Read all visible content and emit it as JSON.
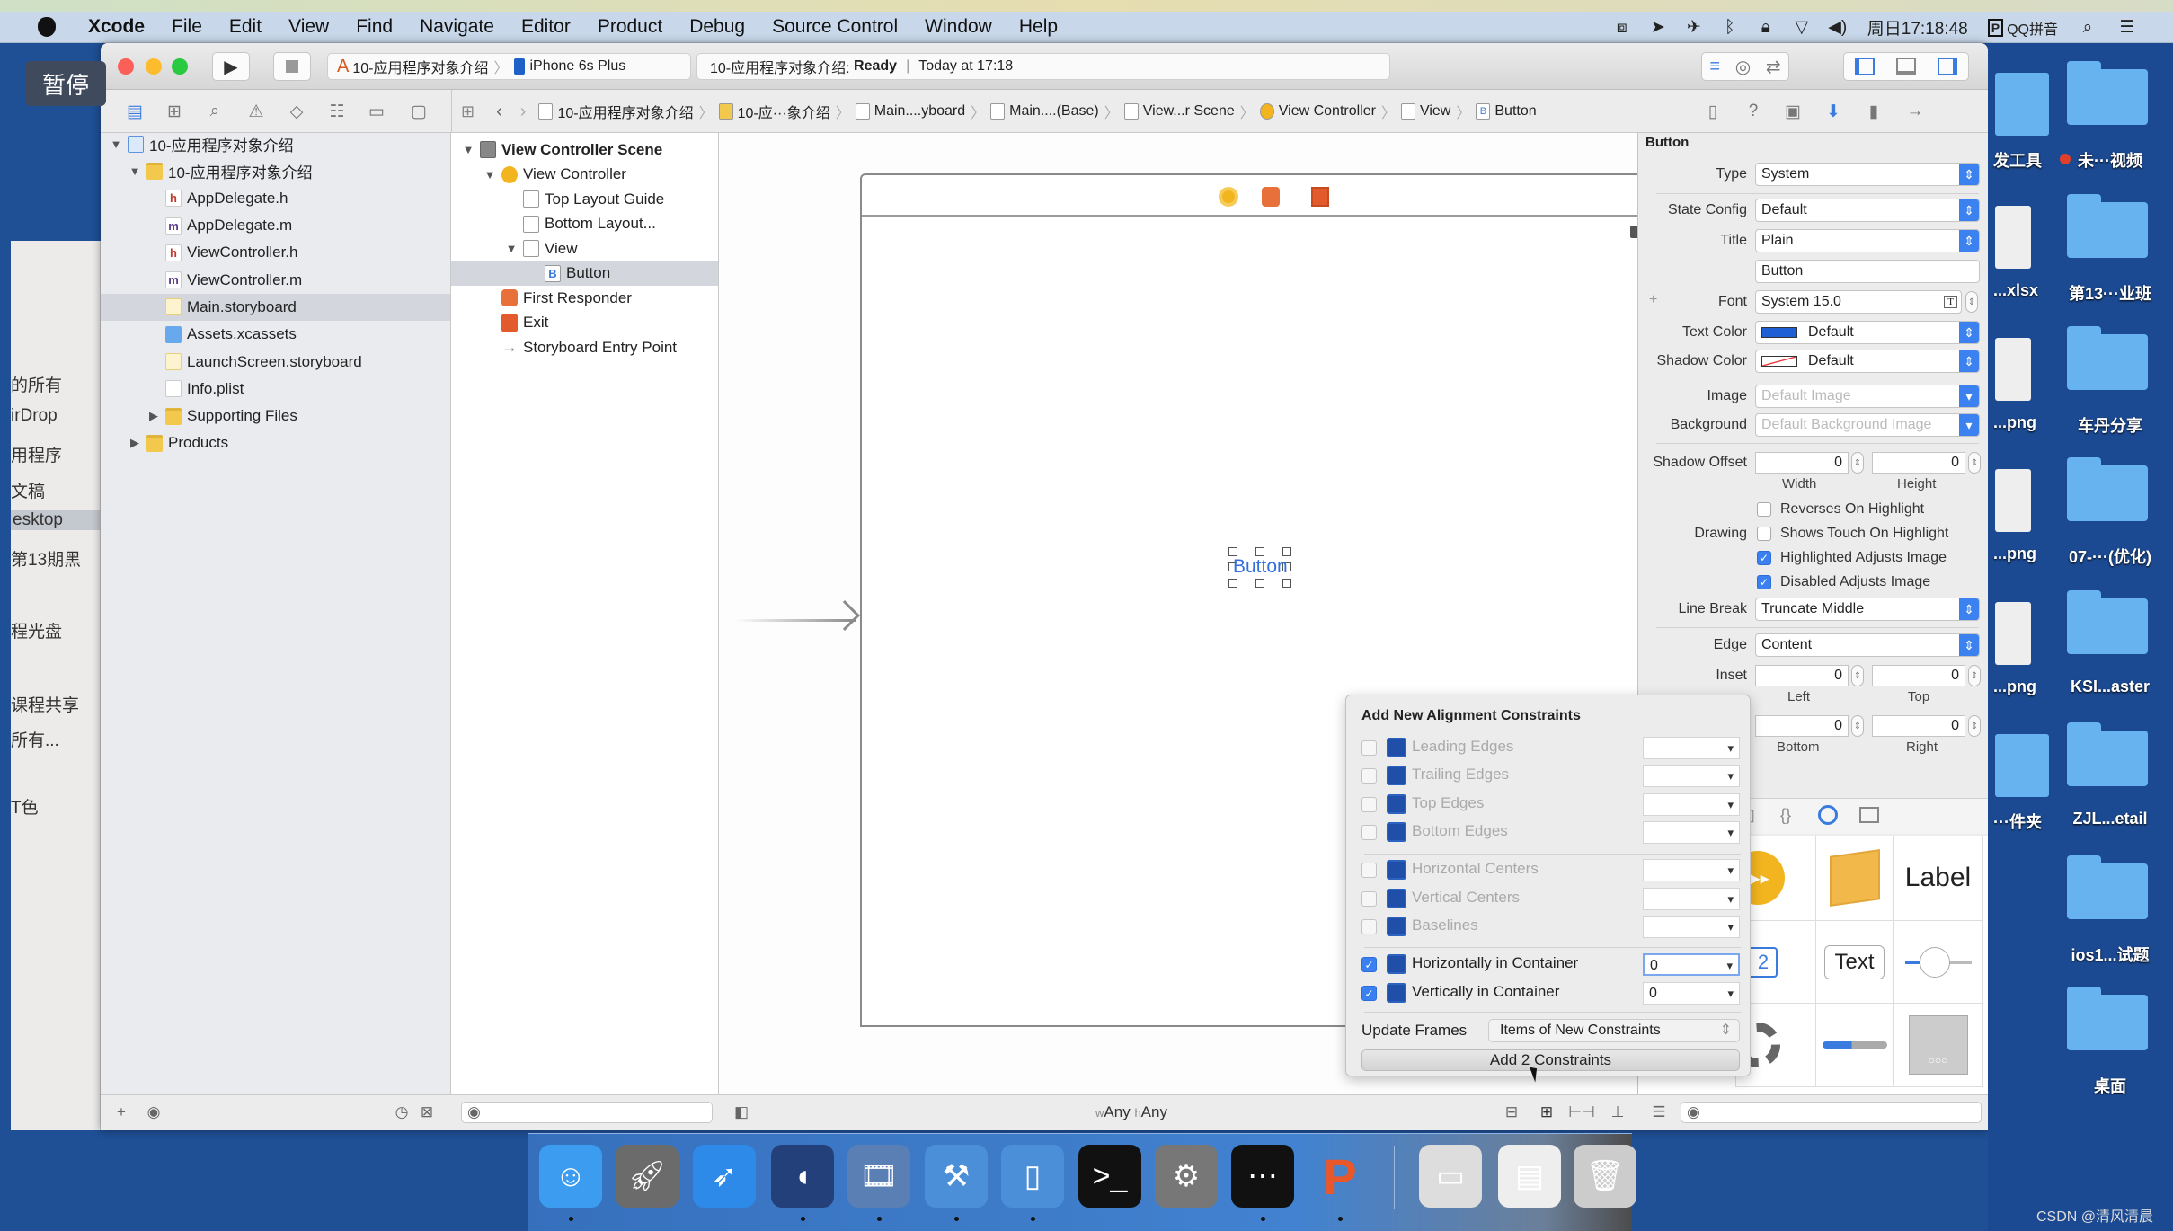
{
  "menubar": {
    "app": "Xcode",
    "items": [
      "File",
      "Edit",
      "View",
      "Find",
      "Navigate",
      "Editor",
      "Product",
      "Debug",
      "Source Control",
      "Window",
      "Help"
    ],
    "status_icons": [
      "screen-record-icon",
      "location-icon",
      "airplane-icon",
      "bluetooth-icon",
      "lock-icon",
      "wifi-icon",
      "volume-icon"
    ],
    "clock": "周日17:18:48",
    "input_method": "QQ拼音"
  },
  "overlay": {
    "pause_label": "暂停",
    "watermark": "CSDN @清风清晨"
  },
  "finder_sidebar": [
    "的所有",
    "irDrop",
    "用程序",
    "文稿",
    "esktop",
    "第13期黑",
    "程光盘",
    "课程共享",
    "所有...",
    "T色"
  ],
  "toolbar": {
    "scheme": "10-应用程序对象介绍",
    "device": "iPhone 6s Plus",
    "status_project": "10-应用程序对象介绍:",
    "status_state": "Ready",
    "status_time": "Today at 17:18"
  },
  "jumpbar": [
    "10-应用程序对象介绍",
    "10-应···象介绍",
    "Main....yboard",
    "Main....(Base)",
    "View...r Scene",
    "View Controller",
    "View",
    "Button"
  ],
  "navigator": {
    "items": [
      {
        "label": "10-应用程序对象介绍",
        "level": 0,
        "icon": "proj",
        "expanded": true
      },
      {
        "label": "10-应用程序对象介绍",
        "level": 1,
        "icon": "folder",
        "expanded": true
      },
      {
        "label": "AppDelegate.h",
        "level": 2,
        "icon": "h"
      },
      {
        "label": "AppDelegate.m",
        "level": 2,
        "icon": "m"
      },
      {
        "label": "ViewController.h",
        "level": 2,
        "icon": "h"
      },
      {
        "label": "ViewController.m",
        "level": 2,
        "icon": "m"
      },
      {
        "label": "Main.storyboard",
        "level": 2,
        "icon": "sb",
        "selected": true
      },
      {
        "label": "Assets.xcassets",
        "level": 2,
        "icon": "assets"
      },
      {
        "label": "LaunchScreen.storyboard",
        "level": 2,
        "icon": "sb"
      },
      {
        "label": "Info.plist",
        "level": 2,
        "icon": "plist"
      },
      {
        "label": "Supporting Files",
        "level": 2,
        "icon": "folder",
        "expanded": false
      },
      {
        "label": "Products",
        "level": 1,
        "icon": "folder",
        "expanded": false
      }
    ]
  },
  "outline": {
    "items": [
      {
        "label": "View Controller Scene",
        "level": 0,
        "icon": "scene",
        "expanded": true,
        "bold": true
      },
      {
        "label": "View Controller",
        "level": 1,
        "icon": "vc",
        "expanded": true
      },
      {
        "label": "Top Layout Guide",
        "level": 2,
        "icon": "guide"
      },
      {
        "label": "Bottom Layout...",
        "level": 2,
        "icon": "guide"
      },
      {
        "label": "View",
        "level": 2,
        "icon": "view",
        "expanded": true
      },
      {
        "label": "Button",
        "level": 3,
        "icon": "btn",
        "selected": true
      },
      {
        "label": "First Responder",
        "level": 1,
        "icon": "fr"
      },
      {
        "label": "Exit",
        "level": 1,
        "icon": "exit"
      },
      {
        "label": "Storyboard Entry Point",
        "level": 1,
        "icon": "entry"
      }
    ]
  },
  "canvas": {
    "button_title": "Button",
    "size_class_w": "w",
    "size_class_w_value": "Any",
    "size_class_h": "h",
    "size_class_h_value": "Any"
  },
  "inspector": {
    "section": "Button",
    "type_label": "Type",
    "type": "System",
    "state_config_label": "State Config",
    "state_config": "Default",
    "title_label": "Title",
    "title_style": "Plain",
    "title_text": "Button",
    "font_label": "Font",
    "font": "System 15.0",
    "text_color_label": "Text Color",
    "text_color": "Default",
    "text_color_swatch": "#1f5fd6",
    "shadow_color_label": "Shadow Color",
    "shadow_color": "Default",
    "image_label": "Image",
    "image_placeholder": "Default Image",
    "background_label": "Background",
    "background_placeholder": "Default Background Image",
    "shadow_offset_label": "Shadow Offset",
    "shadow_width": "0",
    "shadow_height": "0",
    "width_label": "Width",
    "height_label": "Height",
    "drawing_label": "Drawing",
    "drawing_options": [
      {
        "label": "Reverses On Highlight",
        "checked": false
      },
      {
        "label": "Shows Touch On Highlight",
        "checked": false
      },
      {
        "label": "Highlighted Adjusts Image",
        "checked": true
      },
      {
        "label": "Disabled Adjusts Image",
        "checked": true
      }
    ],
    "line_break_label": "Line Break",
    "line_break": "Truncate Middle",
    "edge_label": "Edge",
    "edge": "Content",
    "inset_label": "Inset",
    "inset_left": "0",
    "inset_top": "0",
    "inset_bottom": "0",
    "inset_right": "0",
    "left_label": "Left",
    "top_label": "Top",
    "bottom_label": "Bottom",
    "right_label": "Right"
  },
  "library": {
    "label_item": "Label",
    "text_field_item": "Text",
    "stepper_item": "2"
  },
  "popover": {
    "title": "Add New Alignment Constraints",
    "rows": [
      {
        "label": "Leading Edges",
        "checked": false,
        "value": ""
      },
      {
        "label": "Trailing Edges",
        "checked": false,
        "value": ""
      },
      {
        "label": "Top Edges",
        "checked": false,
        "value": ""
      },
      {
        "label": "Bottom Edges",
        "checked": false,
        "value": ""
      },
      {
        "label": "Horizontal Centers",
        "checked": false,
        "value": ""
      },
      {
        "label": "Vertical Centers",
        "checked": false,
        "value": ""
      },
      {
        "label": "Baselines",
        "checked": false,
        "value": ""
      },
      {
        "label": "Horizontally in Container",
        "checked": true,
        "value": "0"
      },
      {
        "label": "Vertically in Container",
        "checked": true,
        "value": "0"
      }
    ],
    "update_frames_label": "Update Frames",
    "update_frames": "Items of New Constraints",
    "add_button": "Add 2 Constraints"
  },
  "dock": [
    "finder-icon",
    "launchpad-icon",
    "safari-icon",
    "mouse-app-icon",
    "video-app-icon",
    "xcode-icon",
    "simulator-icon",
    "terminal-icon",
    "system-preferences-icon",
    "console-icon",
    "p-app-icon",
    "screenshot-stack-icon",
    "document-stack-icon",
    "trash-icon"
  ],
  "desktop": {
    "col1": [
      "发工具",
      "...xlsx",
      "...png",
      "...png",
      "...png",
      "···件夹"
    ],
    "col2": [
      "未···视频",
      "第13···业班",
      "车丹分享",
      "07-···(优化)",
      "KSI...aster",
      "ZJL...etail",
      "ios1...试题",
      "桌面"
    ]
  },
  "colors": {
    "accent": "#3a80f0",
    "dock": "#3f7ccb",
    "desktop": "#1f4f95"
  }
}
